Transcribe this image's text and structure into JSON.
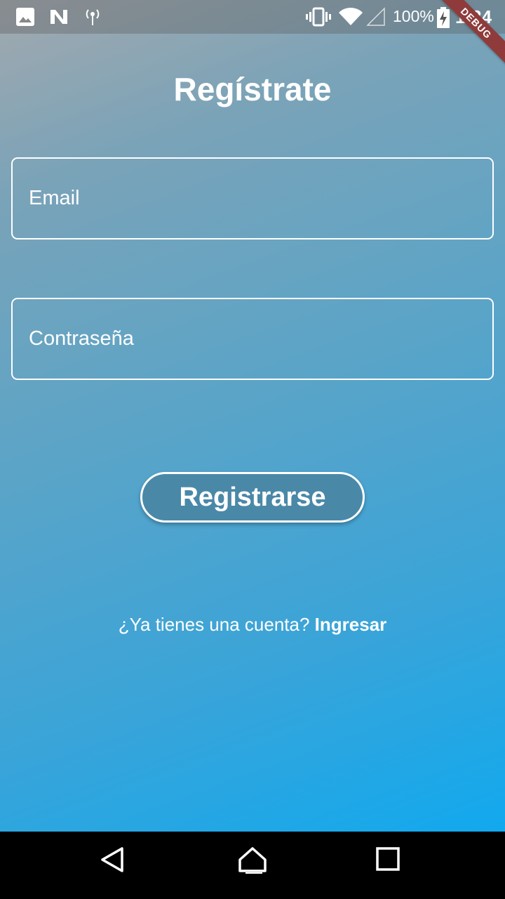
{
  "status_bar": {
    "battery": "100%",
    "time": "1:34",
    "icons": [
      "image-icon",
      "n-notification-icon",
      "hotspot-icon",
      "vibrate-icon",
      "wifi-icon",
      "signal-icon",
      "battery-charging-icon"
    ]
  },
  "debug_banner": "DEBUG",
  "page": {
    "title": "Regístrate"
  },
  "form": {
    "email_placeholder": "Email",
    "password_placeholder": "Contraseña",
    "register_label": "Registrarse",
    "login_prompt": "¿Ya tienes una cuenta?",
    "login_link": "Ingresar"
  },
  "nav_bar": {
    "icons": [
      "back-icon",
      "home-icon",
      "recents-icon"
    ]
  },
  "colors": {
    "gradient_start": "#a3a9ae",
    "gradient_end": "#07aaf4",
    "button_fill": "#4a88a8",
    "debug_banner": "#8f3b3b"
  }
}
